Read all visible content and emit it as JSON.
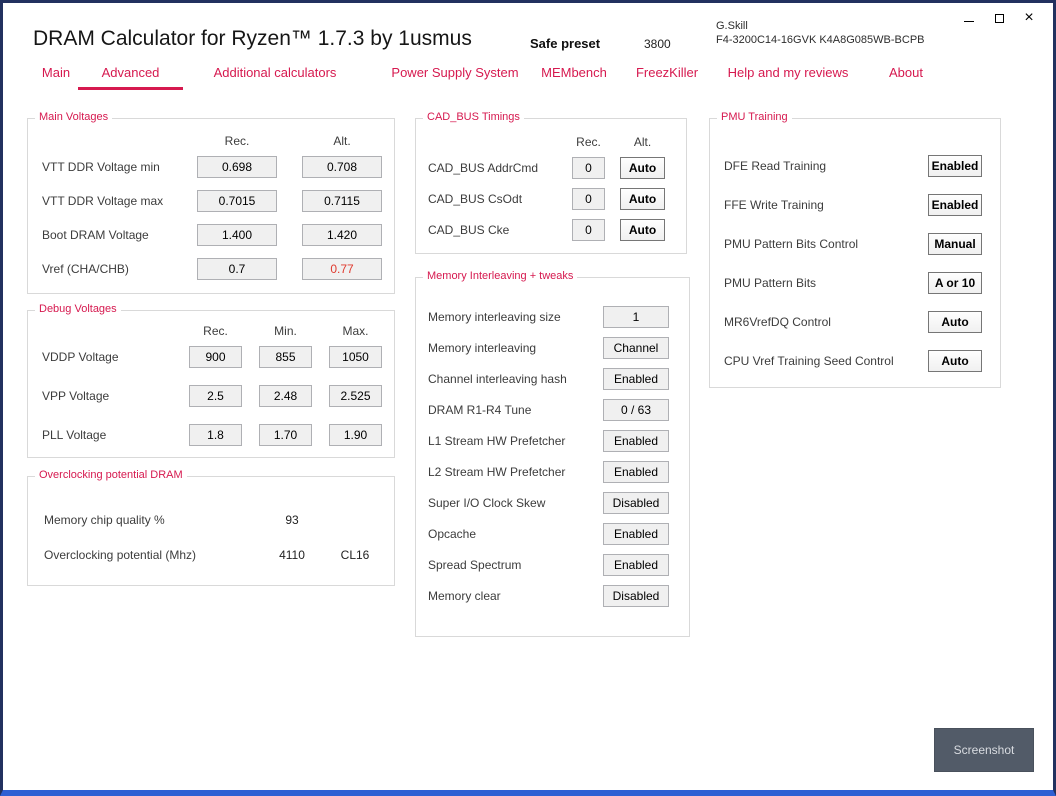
{
  "colors": {
    "accent": "#d6194f",
    "alert_red": "#e03a2e",
    "border_navy": "#22315f",
    "border_blue": "#2e5fd3",
    "input_bg": "#f0f0f0",
    "screenshot_btn_bg": "#525b68"
  },
  "titlebar": {
    "app_title": "DRAM Calculator for Ryzen™ 1.7.3 by 1usmus",
    "preset": "Safe preset",
    "frequency": "3800",
    "ram_vendor": "G.Skill",
    "ram_model": "F4-3200C14-16GVK K4A8G085WB-BCPB",
    "close_glyph": "×"
  },
  "tabs": [
    {
      "label": "Main",
      "active": false
    },
    {
      "label": "Advanced",
      "active": true
    },
    {
      "label": "Additional calculators",
      "active": false
    },
    {
      "label": "Power Supply System",
      "active": false
    },
    {
      "label": "MEMbench",
      "active": false
    },
    {
      "label": "FreezKiller",
      "active": false
    },
    {
      "label": "Help and my reviews",
      "active": false
    },
    {
      "label": "About",
      "active": false
    }
  ],
  "groups": {
    "main_voltages": {
      "title": "Main Voltages",
      "headers": {
        "rec": "Rec.",
        "alt": "Alt."
      },
      "rows": [
        {
          "label": "VTT DDR Voltage min",
          "rec": "0.698",
          "alt": "0.708"
        },
        {
          "label": "VTT DDR Voltage max",
          "rec": "0.7015",
          "alt": "0.7115"
        },
        {
          "label": "Boot DRAM Voltage",
          "rec": "1.400",
          "alt": "1.420"
        },
        {
          "label": "Vref (CHA/CHB)",
          "rec": "0.7",
          "alt": "0.77"
        }
      ]
    },
    "debug_voltages": {
      "title": "Debug Voltages",
      "headers": {
        "rec": "Rec.",
        "min": "Min.",
        "max": "Max."
      },
      "rows": [
        {
          "label": "VDDP Voltage",
          "rec": "900",
          "min": "855",
          "max": "1050"
        },
        {
          "label": "VPP Voltage",
          "rec": "2.5",
          "min": "2.48",
          "max": "2.525"
        },
        {
          "label": "PLL Voltage",
          "rec": "1.8",
          "min": "1.70",
          "max": "1.90"
        }
      ]
    },
    "overclocking": {
      "title": "Overclocking potential DRAM",
      "rows": [
        {
          "label": "Memory chip quality %",
          "value": "93",
          "extra": ""
        },
        {
          "label": "Overclocking potential (Mhz)",
          "value": "4110",
          "extra": "CL16"
        }
      ]
    },
    "cad_bus": {
      "title": "CAD_BUS Timings",
      "headers": {
        "rec": "Rec.",
        "alt": "Alt."
      },
      "rows": [
        {
          "label": "CAD_BUS AddrCmd",
          "rec": "0",
          "alt": "Auto"
        },
        {
          "label": "CAD_BUS CsOdt",
          "rec": "0",
          "alt": "Auto"
        },
        {
          "label": "CAD_BUS Cke",
          "rec": "0",
          "alt": "Auto"
        }
      ]
    },
    "interleaving": {
      "title": "Memory Interleaving + tweaks",
      "rows": [
        {
          "label": "Memory interleaving size",
          "value": "1"
        },
        {
          "label": "Memory interleaving",
          "value": "Channel"
        },
        {
          "label": "Channel interleaving hash",
          "value": "Enabled"
        },
        {
          "label": "DRAM R1-R4 Tune",
          "value": "0 / 63"
        },
        {
          "label": "L1 Stream HW Prefetcher",
          "value": "Enabled"
        },
        {
          "label": "L2 Stream HW Prefetcher",
          "value": "Enabled"
        },
        {
          "label": "Super I/O Clock Skew",
          "value": "Disabled"
        },
        {
          "label": "Opcache",
          "value": "Enabled"
        },
        {
          "label": "Spread Spectrum",
          "value": "Enabled"
        },
        {
          "label": "Memory clear",
          "value": "Disabled"
        }
      ]
    },
    "pmu": {
      "title": "PMU Training",
      "rows": [
        {
          "label": "DFE Read Training",
          "value": "Enabled"
        },
        {
          "label": "FFE Write Training",
          "value": "Enabled"
        },
        {
          "label": "PMU Pattern Bits Control",
          "value": "Manual"
        },
        {
          "label": "PMU Pattern Bits",
          "value": "A or 10"
        },
        {
          "label": "MR6VrefDQ Control",
          "value": "Auto"
        },
        {
          "label": "CPU Vref Training Seed Control",
          "value": "Auto"
        }
      ]
    }
  },
  "footer": {
    "screenshot_label": "Screenshot"
  }
}
